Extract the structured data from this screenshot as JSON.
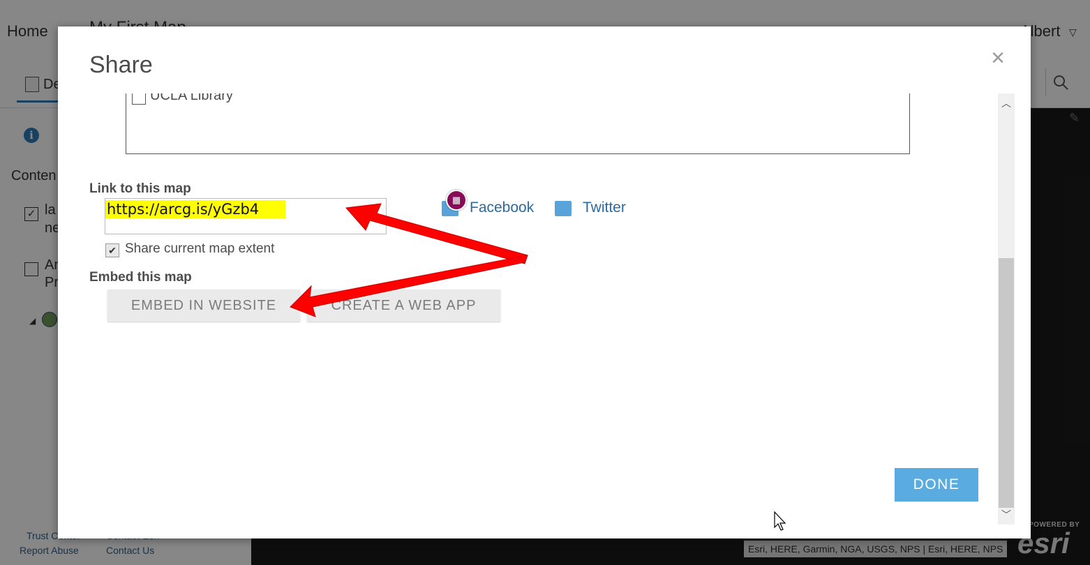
{
  "app": {
    "nav_home": "Home",
    "map_title": "My First Map",
    "user_name": "Albert",
    "details_tab": "De",
    "content_label": "Conten",
    "layers": [
      {
        "line1": "la",
        "line2": "ne",
        "checked": true
      },
      {
        "line1": "An",
        "line2": "Pr",
        "checked": false
      }
    ],
    "footer": {
      "trust": "Trust Center",
      "contact_esri": "Contact Esri",
      "report": "Report Abuse",
      "contact_us": "Contact Us"
    },
    "attribution": "Esri, HERE, Garmin, NGA, USGS, NPS | Esri, HERE, NPS",
    "esri_powered": "POWERED BY",
    "esri_mark": "esri"
  },
  "dialog": {
    "title": "Share",
    "close": "×",
    "groups": [
      {
        "label": "UCLA Library",
        "checked": false
      }
    ],
    "link_section_label": "Link to this map",
    "link_value": "https://arcg.is/yGzb4",
    "share_extent_label": "Share current map extent",
    "share_extent_checked": true,
    "social": {
      "facebook": "Facebook",
      "twitter": "Twitter"
    },
    "embed_section_label": "Embed this map",
    "embed_button": "EMBED IN WEBSITE",
    "webapp_button": "CREATE A WEB APP",
    "done_button": "DONE"
  },
  "colors": {
    "accent": "#5aace0",
    "highlight": "#ffff00",
    "arrow": "#ff0000",
    "link": "#2a6aa0"
  }
}
